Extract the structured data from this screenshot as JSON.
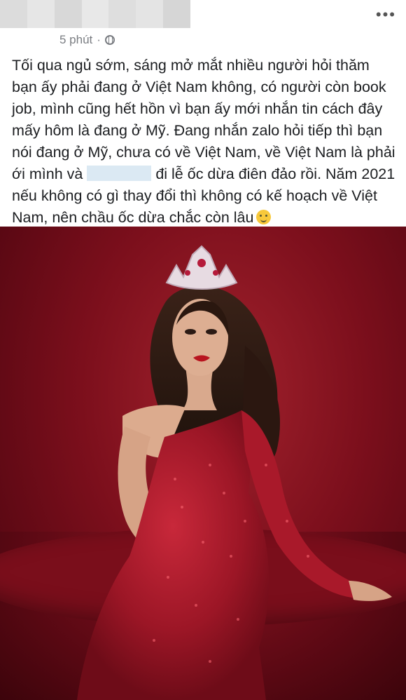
{
  "post": {
    "time": "5 phút",
    "separator": "·",
    "more": "•••",
    "text_part1": "Tối qua ngủ sớm, sáng mở mắt nhiều người hỏi thăm bạn ấy phải đang ở Việt Nam không, có người còn book job, mình cũng hết hồn vì bạn ấy mới nhắn tin cách đây mấy hôm là đang ở Mỹ. Đang nhắn zalo hỏi tiếp thì bạn nói đang ở Mỹ, chưa có về Việt Nam, về Việt Nam là phải ới mình và",
    "text_part2": "đi lễ ốc dừa điên đảo rồi. Năm 2021 nếu không có gì thay đổi thì không có kế hoạch về Việt Nam, nên chầu ốc dừa chắc còn lâu"
  },
  "icons": {
    "globe": "globe-icon",
    "more": "more-options-icon",
    "emoji": "winking-face-emoji"
  },
  "colors": {
    "text": "#1c1e21",
    "meta": "#7a7d82",
    "photo_background": "#7c0f1c",
    "gown": "#b01a2a"
  }
}
